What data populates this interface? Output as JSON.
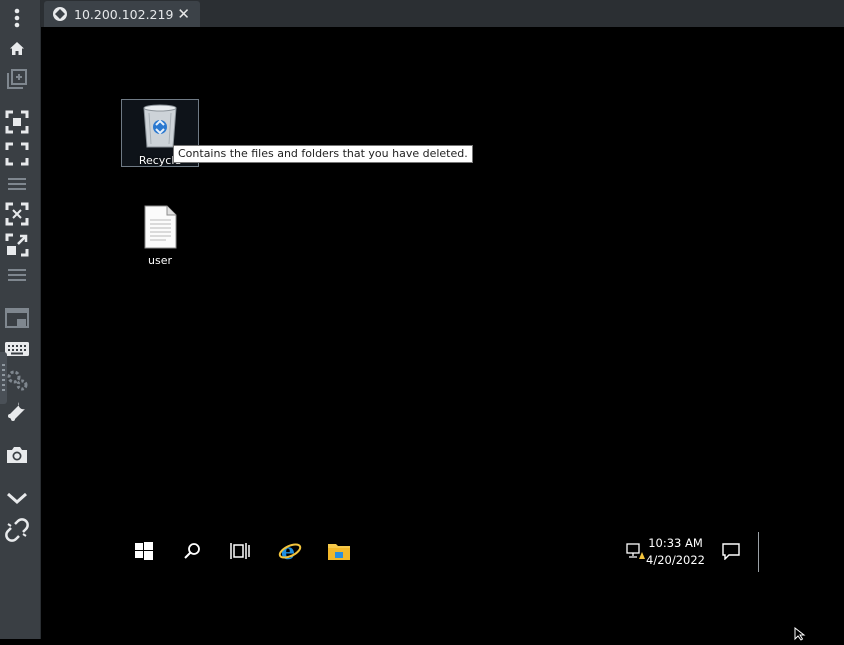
{
  "tab": {
    "title": "10.200.102.219",
    "close_glyph": "✕"
  },
  "desktop": {
    "recycle_bin": {
      "label": "Recycle",
      "tooltip": "Contains the files and folders that you have deleted."
    },
    "user_file": {
      "label": "user"
    }
  },
  "taskbar": {
    "items": [
      "start-icon",
      "search-icon",
      "task-view-icon",
      "internet-explorer-icon",
      "file-explorer-icon"
    ],
    "clock": {
      "time": "10:33 AM",
      "date": "4/20/2022"
    }
  },
  "sidebar": {
    "icons": [
      "more-vertical-icon",
      "home-icon",
      "new-window-icon",
      "fit-screen-icon",
      "fullscreen-icon",
      "menu-icon",
      "scale-icon",
      "expand-icon",
      "menu-icon",
      "display-icon",
      "keyboard-icon",
      "settings-icon",
      "wrench-icon",
      "camera-icon",
      "chevron-down-icon",
      "disconnect-icon"
    ]
  },
  "colors": {
    "sidebar": "#3a3f44",
    "tabbar": "#2b2f33",
    "tab_active": "#3c4248",
    "desktop": "#000000"
  }
}
